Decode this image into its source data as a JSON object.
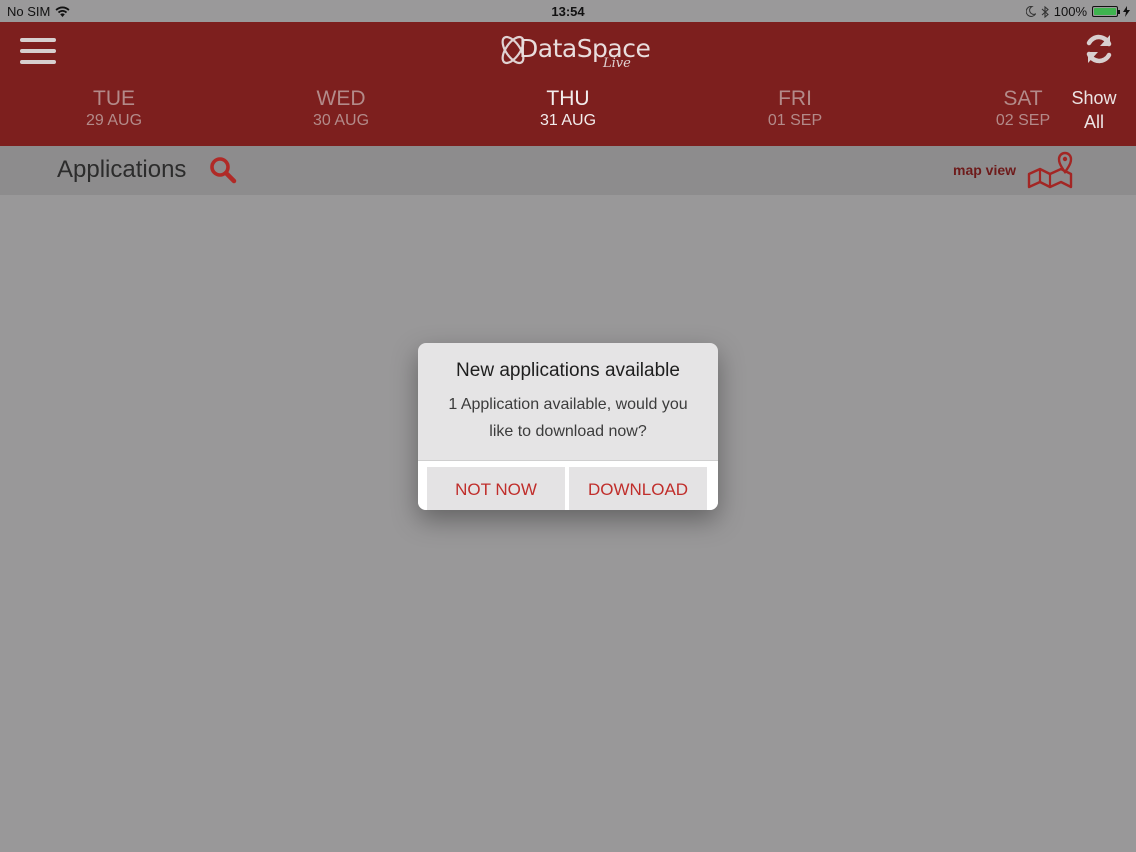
{
  "status_bar": {
    "carrier": "No SIM",
    "time": "13:54",
    "battery": "100%"
  },
  "header": {
    "brand": "DataSpace",
    "brand_sub": "Live",
    "days": [
      {
        "name": "TUE",
        "date": "29 AUG",
        "active": false
      },
      {
        "name": "WED",
        "date": "30 AUG",
        "active": false
      },
      {
        "name": "THU",
        "date": "31 AUG",
        "active": true
      },
      {
        "name": "FRI",
        "date": "01 SEP",
        "active": false
      },
      {
        "name": "SAT",
        "date": "02 SEP",
        "active": false
      }
    ],
    "show_all": {
      "line1": "Show",
      "line2": "All"
    }
  },
  "subbar": {
    "title": "Applications",
    "map_view_label": "map view"
  },
  "dialog": {
    "title": "New applications available",
    "message": "1 Application available, would you like to download now?",
    "buttons": {
      "cancel": "NOT NOW",
      "confirm": "DOWNLOAD"
    }
  },
  "colors": {
    "header_bg": "#7d1f1e",
    "accent_red": "#c02e2b",
    "overlay_bg": "#999899"
  },
  "icons": [
    "wifi-icon",
    "moon-icon",
    "bluetooth-icon",
    "battery-icon",
    "charging-icon",
    "menu-icon",
    "refresh-icon",
    "search-icon",
    "map-pin-icon"
  ]
}
